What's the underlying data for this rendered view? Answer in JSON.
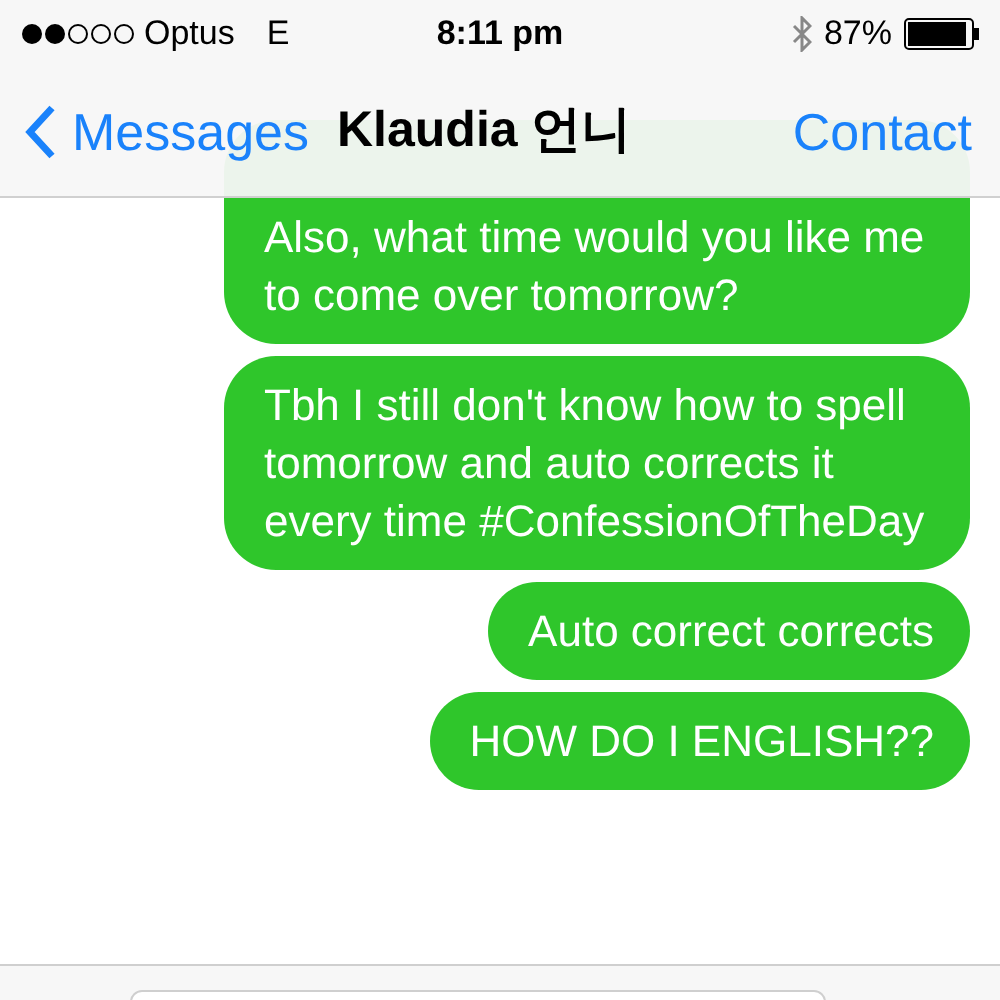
{
  "status_bar": {
    "carrier": "Optus",
    "network": "E",
    "time": "8:11 pm",
    "battery": "87%"
  },
  "nav_bar": {
    "back": "Messages",
    "title": "Klaudia 언니",
    "action": "Contact"
  },
  "messages": [
    {
      "text": "Also, what time would you like me to come over tomorrow?"
    },
    {
      "text": "Tbh I still don't know how to spell tomorrow and auto corrects it every time #ConfessionOfTheDay"
    },
    {
      "text": "Auto correct corrects"
    },
    {
      "text": "HOW DO I ENGLISH??"
    }
  ]
}
